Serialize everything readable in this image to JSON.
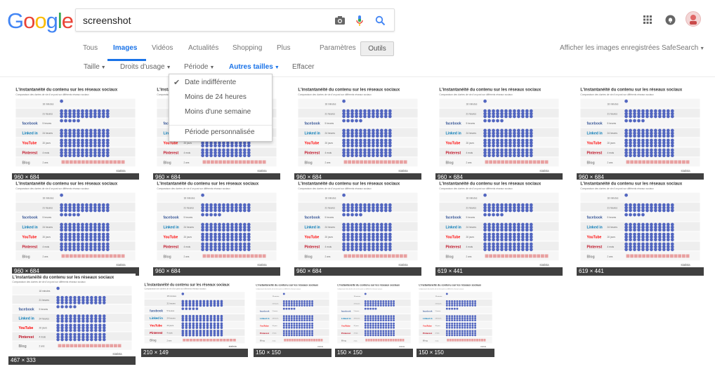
{
  "logo": [
    "G",
    "o",
    "o",
    "g",
    "l",
    "e"
  ],
  "logo_colors": [
    "#4285f4",
    "#ea4335",
    "#fbbc05",
    "#4285f4",
    "#34a853",
    "#ea4335"
  ],
  "search": {
    "query": "screenshot",
    "camera_icon": "camera-icon",
    "mic_icon": "microphone-icon",
    "search_icon": "search-icon"
  },
  "tabs": {
    "all": "Tous",
    "images": "Images",
    "videos": "Vidéos",
    "news": "Actualités",
    "shopping": "Shopping",
    "more": "Plus",
    "settings": "Paramètres",
    "tools": "Outils"
  },
  "right_links": {
    "saved": "Afficher les images enregistrées",
    "safesearch": "SafeSearch"
  },
  "toolbar": {
    "size": "Taille",
    "rights": "Droits d'usage",
    "period": "Période",
    "other_sizes": "Autres tailles",
    "clear": "Effacer"
  },
  "period_menu": {
    "any": "Date indifférente",
    "day": "Moins de 24 heures",
    "week": "Moins d'une semaine",
    "custom": "Période personnalisée"
  },
  "thumb_title": "L'instantanéité du contenu sur les réseaux sociaux",
  "thumb_subtitle": "Comparaison des durées de vie d'un post sur différents réseaux sociaux",
  "thumb_rows": [
    {
      "network": "Twitter",
      "label": "",
      "duration": "18 minutes"
    },
    {
      "network": "Instagram",
      "label": "",
      "duration": "21 heures"
    },
    {
      "network": "Facebook",
      "label": "facebook",
      "duration": "5 heures"
    },
    {
      "network": "LinkedIn",
      "label": "Linked in",
      "duration": "24 heures"
    },
    {
      "network": "YouTube",
      "label": "YouTube",
      "duration": "20 jours"
    },
    {
      "network": "Pinterest",
      "label": "Pinterest",
      "duration": "4 mois"
    },
    {
      "network": "Blog",
      "label": "Blog",
      "duration": "2 ans"
    }
  ],
  "thumb_brand": "statista",
  "images": [
    {
      "dims": "960 × 684"
    },
    {
      "dims": "960 × 684"
    },
    {
      "dims": "960 × 684"
    },
    {
      "dims": "960 × 684"
    },
    {
      "dims": "960 × 684"
    },
    {
      "dims": "960 × 684"
    },
    {
      "dims": "960 × 684"
    },
    {
      "dims": "960 × 684"
    },
    {
      "dims": "619 × 441"
    },
    {
      "dims": "619 × 441"
    },
    {
      "dims": "467 × 333"
    },
    {
      "dims": "210 × 149"
    },
    {
      "dims": "150 × 150"
    },
    {
      "dims": "150 × 150"
    },
    {
      "dims": "150 × 150"
    }
  ]
}
